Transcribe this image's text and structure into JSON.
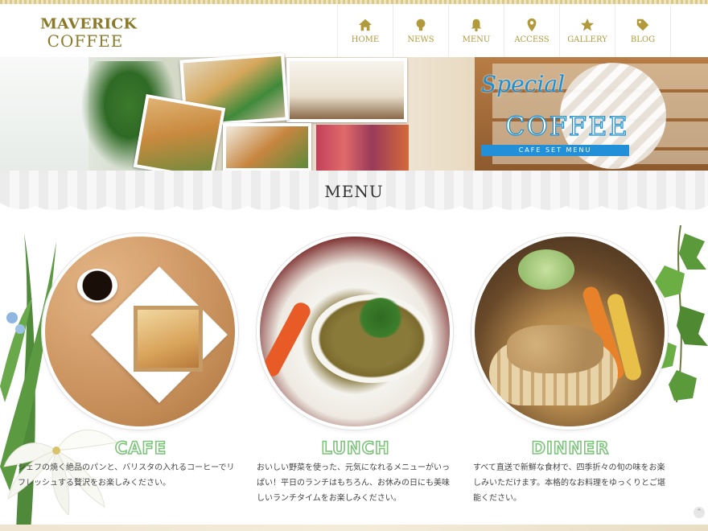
{
  "header": {
    "logo_line1": "MAVERICK",
    "logo_line2": "COFFEE",
    "nav": [
      {
        "label": "HOME",
        "icon": "home-icon"
      },
      {
        "label": "NEWS",
        "icon": "lightbulb-icon"
      },
      {
        "label": "MENU",
        "icon": "bell-icon"
      },
      {
        "label": "ACCESS",
        "icon": "map-pin-icon"
      },
      {
        "label": "GALLERY",
        "icon": "star-icon"
      },
      {
        "label": "BLOG",
        "icon": "tag-icon"
      }
    ]
  },
  "banner": {
    "special_script": "Special",
    "special_title": "COFFEE",
    "special_subtitle": "CAFE SET MENU"
  },
  "section": {
    "title": "MENU"
  },
  "cards": [
    {
      "title": "CAFE",
      "text": "シェフの焼く絶品のパンと、バリスタの入れるコーヒーでリフレッシュする贅沢をお楽しみください。"
    },
    {
      "title": "LUNCH",
      "text": "おいしい野菜を使った、元気になれるメニューがいっぱい！平日のランチはもちろん、お休みの日にも美味しいランチタイムをお楽しみください。"
    },
    {
      "title": "DINNER",
      "text": "すべて直送で新鮮な食材で、四季折々の旬の味をお楽しみいただけます。本格的なお料理をゆっくりとご堪能ください。"
    }
  ],
  "colors": {
    "accent_gold": "#b19a3c",
    "accent_green": "#7cc47a",
    "accent_blue": "#2290d8"
  },
  "pagetop_icon": "chevron-up-icon"
}
